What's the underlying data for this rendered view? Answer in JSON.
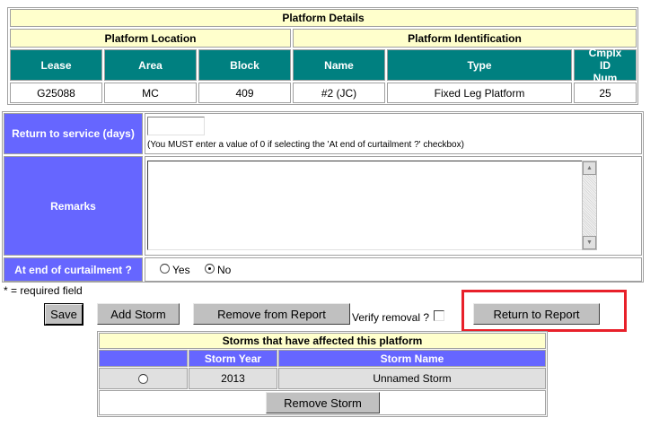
{
  "platform": {
    "title": "Platform Details",
    "location_header": "Platform Location",
    "identification_header": "Platform Identification",
    "columns": [
      "Lease",
      "Area",
      "Block",
      "Name",
      "Type",
      "Cmplx ID Num"
    ],
    "row": [
      "G25088",
      "MC",
      "409",
      "#2 (JC)",
      "Fixed Leg Platform",
      "25"
    ]
  },
  "form": {
    "return_label": "Return to service (days)",
    "return_value": "",
    "return_note": "(You MUST enter a value of 0 if selecting the 'At end of curtailment ?' checkbox)",
    "remarks_label": "Remarks",
    "remarks_value": "",
    "curtailment_label": "At end of curtailment ?",
    "yes_label": "Yes",
    "no_label": "No",
    "selected": "No",
    "required_note": "* = required field"
  },
  "buttons": {
    "save": "Save",
    "add_storm": "Add Storm",
    "remove_from_report": "Remove from Report",
    "verify_removal": "Verify removal ?",
    "return_to_report": "Return to Report",
    "remove_storm": "Remove Storm"
  },
  "storms": {
    "title": "Storms that have affected this platform",
    "columns": [
      "",
      "Storm Year",
      "Storm Name"
    ],
    "rows": [
      {
        "year": "2013",
        "name": "Unnamed Storm"
      }
    ]
  },
  "colors": {
    "teal": "#008080",
    "label_blue": "#6666ff",
    "header_yellow": "#ffffcc",
    "highlight_red": "#e8202a"
  }
}
